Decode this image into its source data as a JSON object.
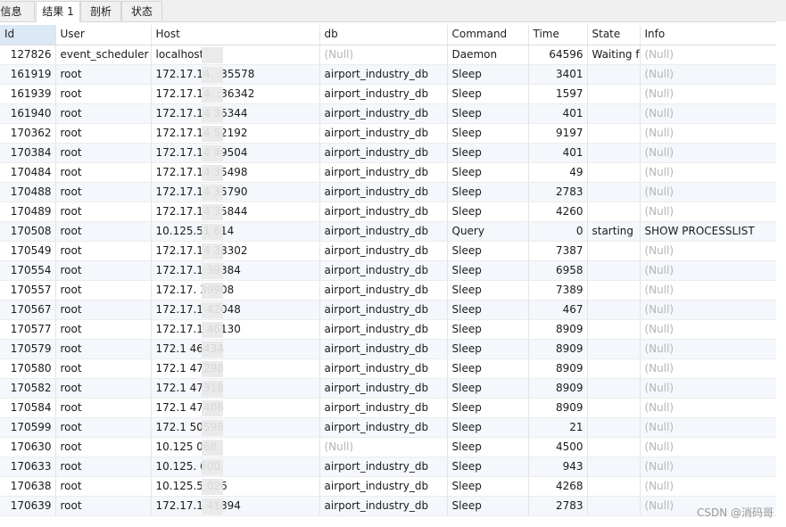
{
  "tabs": [
    {
      "label": "信息",
      "active": false
    },
    {
      "label": "结果 1",
      "active": true
    },
    {
      "label": "剖析",
      "active": false
    },
    {
      "label": "状态",
      "active": false
    }
  ],
  "columns": [
    "Id",
    "User",
    "Host",
    "db",
    "Command",
    "Time",
    "State",
    "Info"
  ],
  "rows": [
    [
      "127826",
      "event_scheduler",
      "localhost",
      "(Null)",
      "Daemon",
      "64596",
      "Waiting fo",
      "(Null)"
    ],
    [
      "161919",
      "root",
      "172.17.14.  :35578",
      "airport_industry_db",
      "Sleep",
      "3401",
      "",
      "(Null)"
    ],
    [
      "161939",
      "root",
      "172.17.14.  :36342",
      "airport_industry_db",
      "Sleep",
      "1597",
      "",
      "(Null)"
    ],
    [
      "161940",
      "root",
      "172.17.14   36344",
      "airport_industry_db",
      "Sleep",
      "401",
      "",
      "(Null)"
    ],
    [
      "170362",
      "root",
      "172.17.14   52192",
      "airport_industry_db",
      "Sleep",
      "9197",
      "",
      "(Null)"
    ],
    [
      "170384",
      "root",
      "172.17.14   49504",
      "airport_industry_db",
      "Sleep",
      "401",
      "",
      "(Null)"
    ],
    [
      "170484",
      "root",
      "172.17.14   35498",
      "airport_industry_db",
      "Sleep",
      "49",
      "",
      "(Null)"
    ],
    [
      "170488",
      "root",
      "172.17.14   35790",
      "airport_industry_db",
      "Sleep",
      "2783",
      "",
      "(Null)"
    ],
    [
      "170489",
      "root",
      "172.17.14   35844",
      "airport_industry_db",
      "Sleep",
      "4260",
      "",
      "(Null)"
    ],
    [
      "170508",
      "root",
      "10.125.51   614",
      "airport_industry_db",
      "Query",
      "0",
      "starting",
      "SHOW PROCESSLIST"
    ],
    [
      "170549",
      "root",
      "172.17.14   38302",
      "airport_industry_db",
      "Sleep",
      "7387",
      "",
      "(Null)"
    ],
    [
      "170554",
      "root",
      "172.17.1   39384",
      "airport_industry_db",
      "Sleep",
      "6958",
      "",
      "(Null)"
    ],
    [
      "170557",
      "root",
      "172.17.   39908",
      "airport_industry_db",
      "Sleep",
      "7389",
      "",
      "(Null)"
    ],
    [
      "170567",
      "root",
      "172.17.1   42048",
      "airport_industry_db",
      "Sleep",
      "467",
      "",
      "(Null)"
    ],
    [
      "170577",
      "root",
      "172.17.1   46130",
      "airport_industry_db",
      "Sleep",
      "8909",
      "",
      "(Null)"
    ],
    [
      "170579",
      "root",
      "172.1   46434",
      "airport_industry_db",
      "Sleep",
      "8909",
      "",
      "(Null)"
    ],
    [
      "170580",
      "root",
      "172.1   47298",
      "airport_industry_db",
      "Sleep",
      "8909",
      "",
      "(Null)"
    ],
    [
      "170582",
      "root",
      "172.1   47318",
      "airport_industry_db",
      "Sleep",
      "8909",
      "",
      "(Null)"
    ],
    [
      "170584",
      "root",
      "172.1   47406",
      "airport_industry_db",
      "Sleep",
      "8909",
      "",
      "(Null)"
    ],
    [
      "170599",
      "root",
      "172.1   50598",
      "airport_industry_db",
      "Sleep",
      "21",
      "",
      "(Null)"
    ],
    [
      "170630",
      "root",
      "10.125   068",
      "(Null)",
      "Sleep",
      "4500",
      "",
      "(Null)"
    ],
    [
      "170633",
      "root",
      "10.125.   600",
      "airport_industry_db",
      "Sleep",
      "943",
      "",
      "(Null)"
    ],
    [
      "170638",
      "root",
      "10.125.5   026",
      "airport_industry_db",
      "Sleep",
      "4268",
      "",
      "(Null)"
    ],
    [
      "170639",
      "root",
      "172.17.1   41894",
      "airport_industry_db",
      "Sleep",
      "2783",
      "",
      "(Null)"
    ]
  ],
  "watermark": "CSDN @消码哥"
}
